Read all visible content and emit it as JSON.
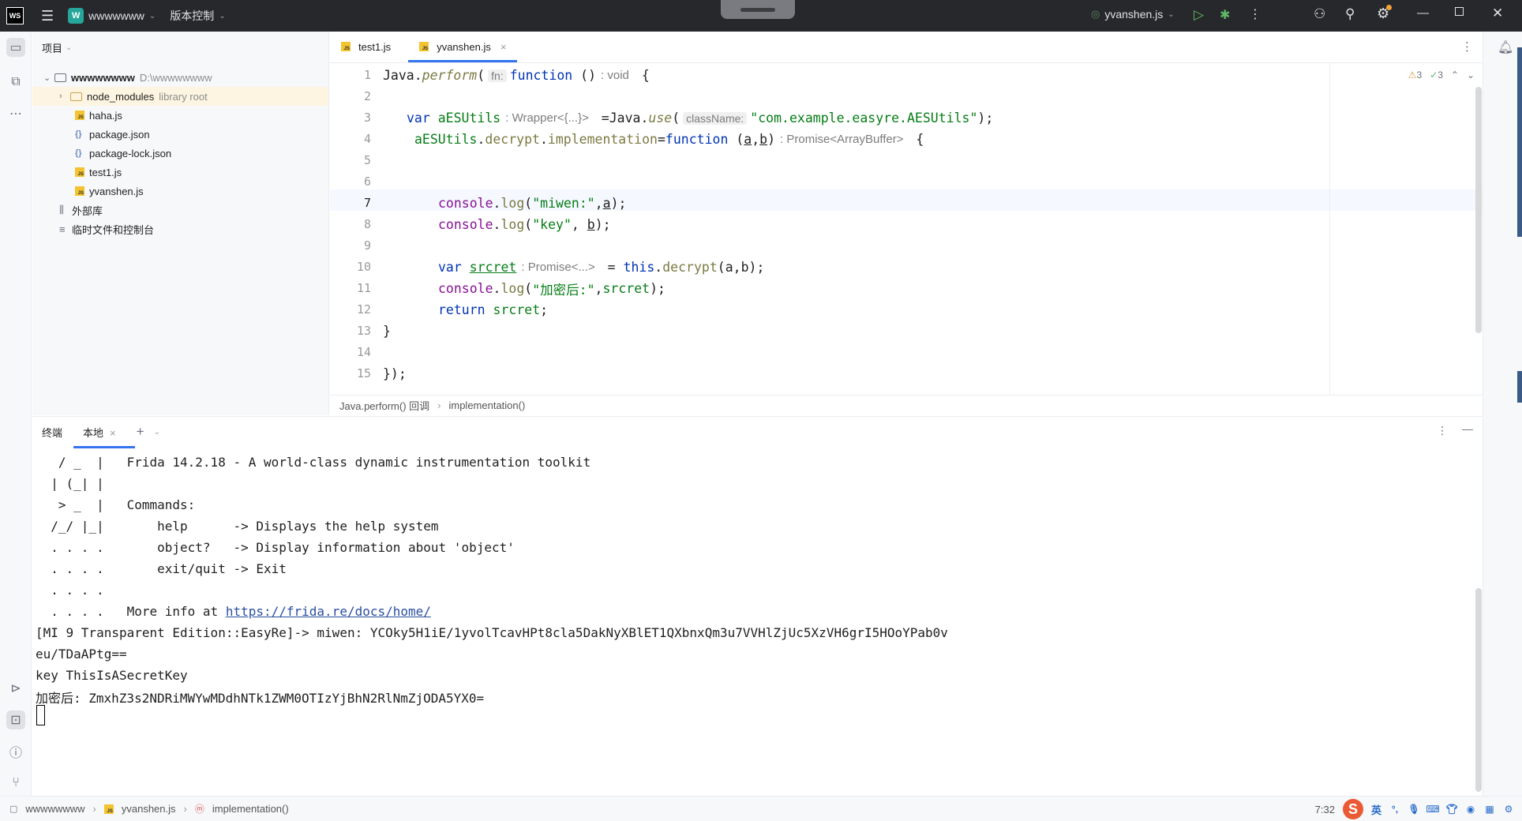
{
  "titlebar": {
    "app_logo": "WS",
    "project_badge": "W",
    "project_name": "wwwwwww",
    "vcs_label": "版本控制",
    "run_config": "yvanshen.js"
  },
  "project_panel": {
    "header": "项目",
    "tree": [
      {
        "label": "wwwwwwww",
        "hint": "D:\\wwwwwwww"
      },
      {
        "label": "node_modules",
        "hint": "library root"
      },
      {
        "label": "haha.js",
        "hint": ""
      },
      {
        "label": "package.json",
        "hint": ""
      },
      {
        "label": "package-lock.json",
        "hint": ""
      },
      {
        "label": "test1.js",
        "hint": ""
      },
      {
        "label": "yvanshen.js",
        "hint": ""
      },
      {
        "label": "外部库",
        "hint": ""
      },
      {
        "label": "临时文件和控制台",
        "hint": ""
      }
    ]
  },
  "editor": {
    "tabs": [
      {
        "label": "test1.js",
        "badge": "JS"
      },
      {
        "label": "yvanshen.js",
        "badge": "JS",
        "close": "×"
      }
    ],
    "line_numbers": [
      "1",
      "2",
      "3",
      "4",
      "5",
      "6",
      "7",
      "8",
      "9",
      "10",
      "11",
      "12",
      "13",
      "14",
      "15"
    ],
    "code": {
      "l1_a": "Java.",
      "l1_b": "perform",
      "l1_c": "(",
      "l1_hint": "fn:",
      "l1_d": "function",
      "l1_e": " ()",
      "l1_type": ": void",
      "l1_f": " {",
      "l3_a": "var ",
      "l3_b": "aESUtils",
      "l3_type": ": Wrapper<{...}>",
      "l3_c": " =Java.",
      "l3_d": "use",
      "l3_e": "(",
      "l3_hint": "className:",
      "l3_f": "\"com.example.easyre.AESUtils\"",
      "l3_g": ");",
      "l4_a": "aESUtils",
      "l4_b": ".",
      "l4_c": "decrypt",
      "l4_d": ".",
      "l4_e": "implementation",
      "l4_f": "=",
      "l4_g": "function",
      "l4_h": " (",
      "l4_i": "a",
      "l4_j": ",",
      "l4_k": "b",
      "l4_l": ")",
      "l4_type": ": Promise<ArrayBuffer>",
      "l4_m": " {",
      "l7_a": "console",
      "l7_b": ".",
      "l7_c": "log",
      "l7_d": "(",
      "l7_e": "\"miwen:\"",
      "l7_f": ",",
      "l7_g": "a",
      "l7_h": ");",
      "l8_a": "console",
      "l8_b": ".",
      "l8_c": "log",
      "l8_d": "(",
      "l8_e": "\"key\"",
      "l8_f": ", ",
      "l8_g": "b",
      "l8_h": ");",
      "l10_a": "var ",
      "l10_b": "srcret",
      "l10_type": ": Promise<...>",
      "l10_c": " = ",
      "l10_d": "this",
      "l10_e": ".",
      "l10_f": "decrypt",
      "l10_g": "(a,b);",
      "l11_a": "console",
      "l11_b": ".",
      "l11_c": "log",
      "l11_d": "(",
      "l11_e": "\"加密后:\"",
      "l11_f": ",",
      "l11_g": "srcret",
      "l11_h": ");",
      "l12_a": "return ",
      "l12_b": "srcret",
      "l12_c": ";",
      "l13": "}",
      "l15": "});"
    },
    "inspections": {
      "warnings": "3",
      "ok": "3"
    },
    "breadcrumb": [
      "Java.perform() 回调",
      "implementation()"
    ]
  },
  "terminal": {
    "tab_title": "终端",
    "tab_local": "本地",
    "lines": [
      "   / _  |   Frida 14.2.18 - A world-class dynamic instrumentation toolkit",
      "  | (_| |",
      "   > _  |   Commands:",
      "  /_/ |_|       help      -> Displays the help system",
      "  . . . .       object?   -> Display information about 'object'",
      "  . . . .       exit/quit -> Exit",
      "  . . . .",
      "[MI 9 Transparent Edition::EasyRe]-> miwen: YCOky5H1iE/1yvolTcavHPt8cla5DakNyXBlET1QXbnxQm3u7VVHlZjUc5XzVH6grI5HOoYPab0v",
      "eu/TDaAPtg==",
      "key ThisIsASecretKey",
      "加密后: ZmxhZ3s2NDRiMWYwMDdhNTk1ZWM0OTIzYjBhN2RlNmZjODA5YX0="
    ],
    "more_info_prefix": "  . . . .   More info at ",
    "more_info_link": "https://frida.re/docs/home/"
  },
  "statusbar": {
    "crumbs": [
      "wwwwwwww",
      "yvanshen.js",
      "implementation()"
    ],
    "position": "7:32",
    "ime_logo": "S",
    "ime_lang": "英"
  }
}
